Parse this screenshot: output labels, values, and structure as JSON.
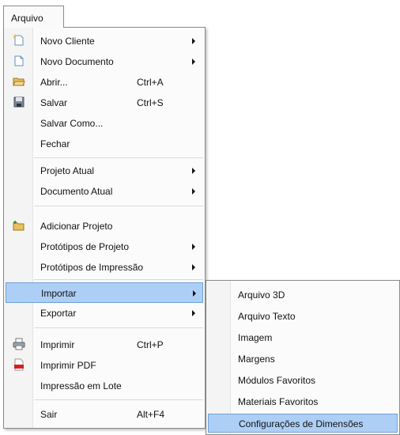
{
  "menubar": {
    "label": "Arquivo"
  },
  "main_menu": {
    "items": [
      {
        "label": "Novo Cliente",
        "shortcut": "",
        "submenu": true,
        "icon": "new-client-icon"
      },
      {
        "label": "Novo Documento",
        "shortcut": "",
        "submenu": true,
        "icon": "new-document-icon"
      },
      {
        "label": "Abrir...",
        "shortcut": "Ctrl+A",
        "submenu": false,
        "icon": "open-folder-icon"
      },
      {
        "label": "Salvar",
        "shortcut": "Ctrl+S",
        "submenu": false,
        "icon": "save-icon"
      },
      {
        "label": "Salvar Como...",
        "shortcut": "",
        "submenu": false,
        "icon": ""
      },
      {
        "label": "Fechar",
        "shortcut": "",
        "submenu": false,
        "icon": ""
      },
      {
        "label": "Projeto Atual",
        "shortcut": "",
        "submenu": true,
        "icon": ""
      },
      {
        "label": "Documento Atual",
        "shortcut": "",
        "submenu": true,
        "icon": ""
      },
      {
        "label": "Adicionar Projeto",
        "shortcut": "",
        "submenu": false,
        "icon": "add-project-icon"
      },
      {
        "label": "Protótipos de Projeto",
        "shortcut": "",
        "submenu": true,
        "icon": ""
      },
      {
        "label": "Protótipos de Impressão",
        "shortcut": "",
        "submenu": true,
        "icon": ""
      },
      {
        "label": "Importar",
        "shortcut": "",
        "submenu": true,
        "icon": "",
        "highlighted": true
      },
      {
        "label": "Exportar",
        "shortcut": "",
        "submenu": true,
        "icon": ""
      },
      {
        "label": "Imprimir",
        "shortcut": "Ctrl+P",
        "submenu": false,
        "icon": "printer-icon"
      },
      {
        "label": "Imprimir PDF",
        "shortcut": "",
        "submenu": false,
        "icon": "pdf-icon"
      },
      {
        "label": "Impressão em Lote",
        "shortcut": "",
        "submenu": false,
        "icon": ""
      },
      {
        "label": "Sair",
        "shortcut": "Alt+F4",
        "submenu": false,
        "icon": ""
      }
    ]
  },
  "sub_menu": {
    "items": [
      {
        "label": "Arquivo 3D"
      },
      {
        "label": "Arquivo Texto"
      },
      {
        "label": "Imagem"
      },
      {
        "label": "Margens"
      },
      {
        "label": "Módulos Favoritos"
      },
      {
        "label": "Materiais Favoritos"
      },
      {
        "label": "Configurações de Dimensões",
        "highlighted": true
      }
    ]
  },
  "colors": {
    "highlight": "#aecff5",
    "highlight_border": "#6ea0d8",
    "pdf_red": "#d32020"
  }
}
